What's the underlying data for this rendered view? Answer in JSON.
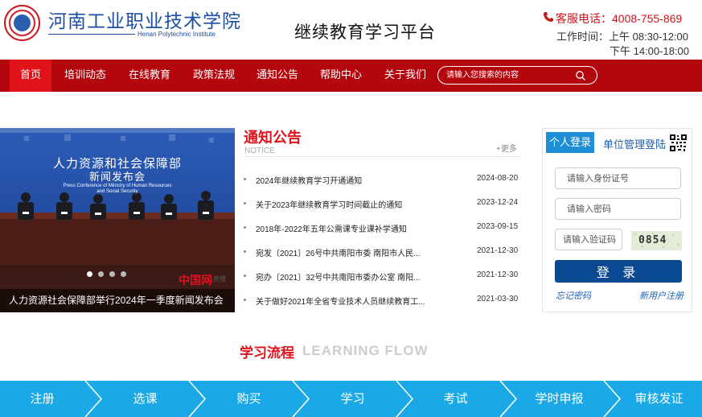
{
  "header": {
    "school_name": "河南工业职业技术学院",
    "school_name_en": "Henan Polytechnic Institute",
    "platform_title": "继续教育学习平台",
    "hotline": "客服电话：4008-755-869",
    "hours_line1": "工作时间：上午 08:30-12:00",
    "hours_line2": "下午 14:00-18:00"
  },
  "nav": {
    "items": [
      {
        "label": "首页",
        "active": true
      },
      {
        "label": "培训动态"
      },
      {
        "label": "在线教育"
      },
      {
        "label": "政策法规"
      },
      {
        "label": "通知公告"
      },
      {
        "label": "帮助中心"
      },
      {
        "label": "关于我们"
      }
    ],
    "search_placeholder": "请输入您搜索的内容"
  },
  "banner": {
    "caption": "人力资源社会保障部举行2024年一季度新闻发布会",
    "board_line1": "人力资源和社会保障部",
    "board_line2": "新闻发布会",
    "board_en": "Press Conference of Ministry of Human Resources and Social Security",
    "watermark": "中国网",
    "watermark_sub": "直播",
    "slide_count": 4,
    "active_slide": 1
  },
  "notice": {
    "title": "通知公告",
    "title_en": "NOTICE",
    "more": "+更多",
    "items": [
      {
        "title": "2024年继续教育学习开通通知",
        "date": "2024-08-20"
      },
      {
        "title": "关于2023年继续教育学习时间截止的通知",
        "date": "2023-12-24"
      },
      {
        "title": "2018年-2022年五年公需课专业课补学通知",
        "date": "2023-09-15"
      },
      {
        "title": "宛发〔2021〕26号中共南阳市委 南阳市人民...",
        "date": "2021-12-30"
      },
      {
        "title": "宛办〔2021〕32号中共南阳市委办公室 南阳...",
        "date": "2021-12-30"
      },
      {
        "title": "关于做好2021年全省专业技术人员继续教育工...",
        "date": "2021-03-30"
      }
    ]
  },
  "login": {
    "tab_personal": "个人登录",
    "tab_unit": "单位管理登陆",
    "id_placeholder": "请输入身份证号",
    "password_placeholder": "请输入密码",
    "captcha_placeholder": "请输入验证码",
    "captcha_code": "0854",
    "login_button": "登 录",
    "forgot": "忘记密码",
    "register": "新用户注册"
  },
  "flow": {
    "title_cn": "学习流程",
    "title_en": "LEARNING  FLOW",
    "steps": [
      "注册",
      "选课",
      "购买",
      "学习",
      "考试",
      "学时申报",
      "审核发证"
    ]
  },
  "colors": {
    "nav_bg": "#b3060d",
    "nav_active": "#e0131b",
    "accent_red": "#e0131b",
    "brand_blue": "#1c4fa3",
    "login_button": "#0b4a93",
    "flow_bar": "#1aa9e6"
  }
}
